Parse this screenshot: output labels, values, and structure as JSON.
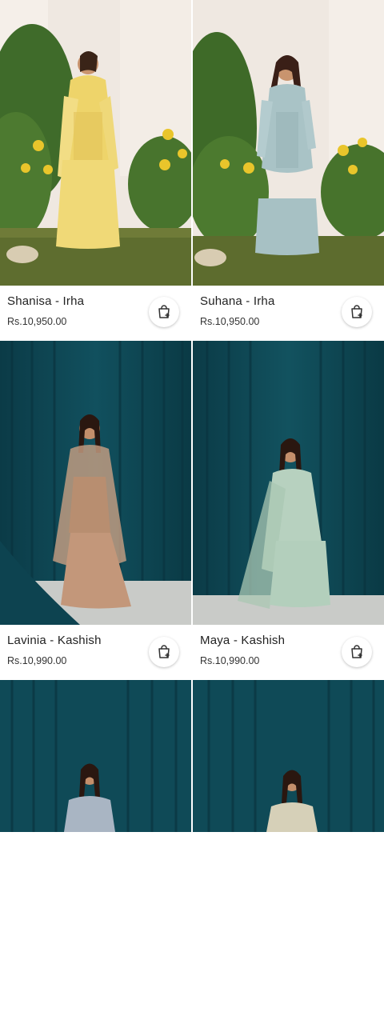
{
  "products": [
    {
      "name": "Shanisa - Irha",
      "price": "Rs.10,950.00",
      "cart_icon": "shopping-bag-plus-icon"
    },
    {
      "name": "Suhana - Irha",
      "price": "Rs.10,950.00",
      "cart_icon": "shopping-bag-plus-icon"
    },
    {
      "name": "Lavinia - Kashish",
      "price": "Rs.10,990.00",
      "cart_icon": "shopping-bag-plus-icon"
    },
    {
      "name": "Maya - Kashish",
      "price": "Rs.10,990.00",
      "cart_icon": "shopping-bag-plus-icon"
    }
  ],
  "colors": {
    "teal_curtain": "#0f4a57",
    "garden_grass": "#5b6a2e",
    "backdrop_white": "#ede6df"
  }
}
